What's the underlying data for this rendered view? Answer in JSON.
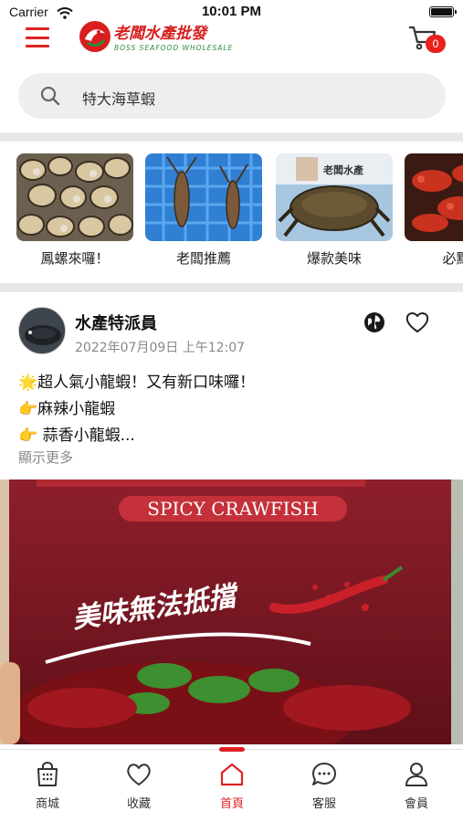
{
  "status_bar": {
    "carrier": "Carrier",
    "time": "10:01 PM"
  },
  "header": {
    "logo_text": "老闆水產批發",
    "logo_subtext": "BOSS SEAFOOD WHOLESALE",
    "cart_count": "0",
    "brand_color": "#e02222"
  },
  "search": {
    "placeholder": "特大海草蝦"
  },
  "categories": [
    {
      "label": "鳳螺來囉！",
      "icon": "sea-snails-photo"
    },
    {
      "label": "老闆推薦",
      "icon": "lobster-photo"
    },
    {
      "label": "爆款美味",
      "icon": "crab-photo"
    },
    {
      "label": "必點下",
      "icon": "crawfish-photo"
    }
  ],
  "post": {
    "author": "水產特派員",
    "date": "2022年07月09日 上午12:07",
    "lines": [
      "🌟超人氣小龍蝦！又有新口味囉！",
      "👉麻辣小龍蝦",
      "👉 蒜香小龍蝦..."
    ],
    "more_label": "顯示更多",
    "image": {
      "banner_text": "SPICY CRAWFISH",
      "calligraphy_text": "美味無法抵擋"
    }
  },
  "tabbar": {
    "items": [
      {
        "label": "商城",
        "icon": "shop-icon"
      },
      {
        "label": "收藏",
        "icon": "heart-icon"
      },
      {
        "label": "首頁",
        "icon": "home-icon"
      },
      {
        "label": "客服",
        "icon": "chat-icon"
      },
      {
        "label": "會員",
        "icon": "user-icon"
      }
    ],
    "active_index": 2
  }
}
